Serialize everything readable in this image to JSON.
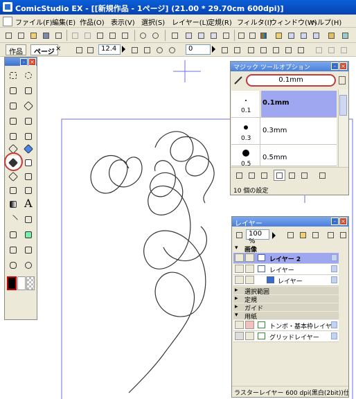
{
  "window": {
    "title": "ComicStudio EX - [[新規作品 - 1ページ] (21.00 * 29.70cm 600dpi)]"
  },
  "menu": [
    "ファイル(F)",
    "編集(E)",
    "作品(O)",
    "表示(V)",
    "選択(S)",
    "レイヤー(L)",
    "定規(R)",
    "フィルタ(I)",
    "ウィンドウ(W)",
    "ヘルプ(H)"
  ],
  "tabs": {
    "work": "作品",
    "page": "ページ",
    "close": "×"
  },
  "toolbar2": {
    "rotation_value": "12.4",
    "zoom_value": "0"
  },
  "magic_options": {
    "title": "マジック ツールオプション",
    "selected": "0.1mm",
    "rows": [
      {
        "label": "0.1",
        "name": "0.1mm"
      },
      {
        "label": "0.3",
        "name": "0.3mm"
      },
      {
        "label": "0.5",
        "name": "0.5mm"
      }
    ],
    "status": "10 個の設定"
  },
  "layers": {
    "title": "レイヤー",
    "opacity": "100 %",
    "group_image": "画像",
    "items": [
      {
        "name": "レイヤー 2",
        "selected": true
      },
      {
        "name": "レイヤー",
        "selected": false
      },
      {
        "name": "レイヤー",
        "selected": false
      }
    ],
    "folders": [
      "選択範囲",
      "定規",
      "ガイド",
      "用紙"
    ],
    "paper_items": [
      "トンボ・基本枠レイヤー",
      "グリッドレイヤー"
    ],
    "status": "ラスターレイヤー 600 dpi(黒白(2bit))仕..."
  },
  "colors": {
    "titlebar": "#0842b0",
    "selected_row": "#9fa7f0",
    "highlight_circle": "#c23a3a"
  }
}
